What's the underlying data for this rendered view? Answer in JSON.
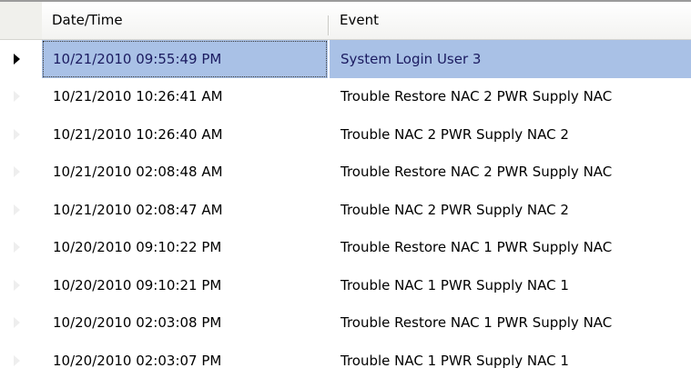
{
  "grid": {
    "columns": [
      "Date/Time",
      "Event"
    ],
    "selected_row_index": 0,
    "selection_color": "#a9c1e6",
    "rows": [
      {
        "datetime": "10/21/2010 09:55:49 PM",
        "event": "System Login User 3"
      },
      {
        "datetime": "10/21/2010 10:26:41 AM",
        "event": "Trouble Restore NAC 2 PWR Supply NAC"
      },
      {
        "datetime": "10/21/2010 10:26:40 AM",
        "event": "Trouble NAC 2 PWR Supply NAC 2"
      },
      {
        "datetime": "10/21/2010 02:08:48 AM",
        "event": "Trouble Restore NAC 2 PWR Supply NAC"
      },
      {
        "datetime": "10/21/2010 02:08:47 AM",
        "event": "Trouble NAC 2 PWR Supply NAC 2"
      },
      {
        "datetime": "10/20/2010 09:10:22 PM",
        "event": "Trouble Restore NAC 1 PWR Supply NAC"
      },
      {
        "datetime": "10/20/2010 09:10:21 PM",
        "event": "Trouble NAC 1 PWR Supply NAC 1"
      },
      {
        "datetime": "10/20/2010 02:03:08 PM",
        "event": "Trouble Restore NAC 1 PWR Supply NAC"
      },
      {
        "datetime": "10/20/2010 02:03:07 PM",
        "event": "Trouble NAC 1 PWR Supply NAC 1"
      }
    ]
  }
}
